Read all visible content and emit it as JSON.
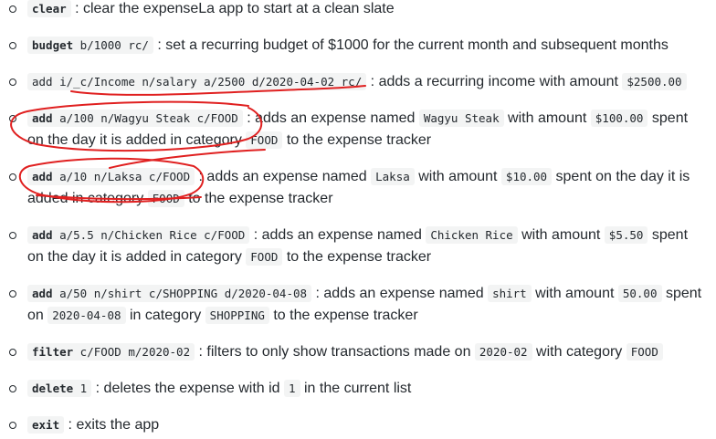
{
  "items": [
    {
      "cmd": "clear",
      "args": "",
      "desc": " : clear the expenseLa app to start at a clean slate"
    },
    {
      "cmd": "budget",
      "args": " b/1000 rc/",
      "desc": " : set a recurring budget of $1000 for the current month and subsequent months"
    },
    {
      "cmd": "",
      "args": "add i/_c/Income n/salary a/2500 d/2020-04-02 rc/",
      "desc1": " : adds a recurring income with amount ",
      "code1": "$2500.00",
      "desc2": ""
    },
    {
      "cmd": "add",
      "args": " a/100 n/Wagyu Steak c/FOOD",
      "desc1": " : adds an expense named ",
      "code1": "Wagyu Steak",
      "desc2": " with amount ",
      "code2": "$100.00",
      "desc3": " spent on the day it is added in category ",
      "code3": "FOOD",
      "desc4": " to the expense tracker"
    },
    {
      "cmd": "add",
      "args": " a/10 n/Laksa c/FOOD",
      "desc1": " : adds an expense named ",
      "code1": "Laksa",
      "desc2": " with amount ",
      "code2": "$10.00",
      "desc3": " spent on the day it is added in category ",
      "code3": "FOOD",
      "desc4": " to the expense tracker"
    },
    {
      "cmd": "add",
      "args": " a/5.5 n/Chicken Rice c/FOOD",
      "desc1": " : adds an expense named ",
      "code1": "Chicken Rice",
      "desc2": " with amount ",
      "code2": "$5.50",
      "desc3": " spent on the day it is added in category ",
      "code3": "FOOD",
      "desc4": " to the expense tracker"
    },
    {
      "cmd": "add",
      "args": " a/50 n/shirt c/SHOPPING d/2020-04-08",
      "desc1": " : adds an expense named ",
      "code1": "shirt",
      "desc2": " with amount ",
      "code2": "50.00",
      "desc3": " spent on ",
      "code3": "2020-04-08",
      "desc4": " in category ",
      "code4": "SHOPPING",
      "desc5": " to the expense tracker"
    },
    {
      "cmd": "filter",
      "args": " c/FOOD m/2020-02",
      "desc1": " : filters to only show transactions made on ",
      "code1": "2020-02",
      "desc2": " with category ",
      "code2": "FOOD"
    },
    {
      "cmd": "delete",
      "args": " 1",
      "desc1": " : deletes the expense with id ",
      "code1": "1",
      "desc2": " in the current list"
    },
    {
      "cmd": "exit",
      "args": "",
      "desc": " : exits the app"
    }
  ],
  "annotation_color": "#e02020"
}
